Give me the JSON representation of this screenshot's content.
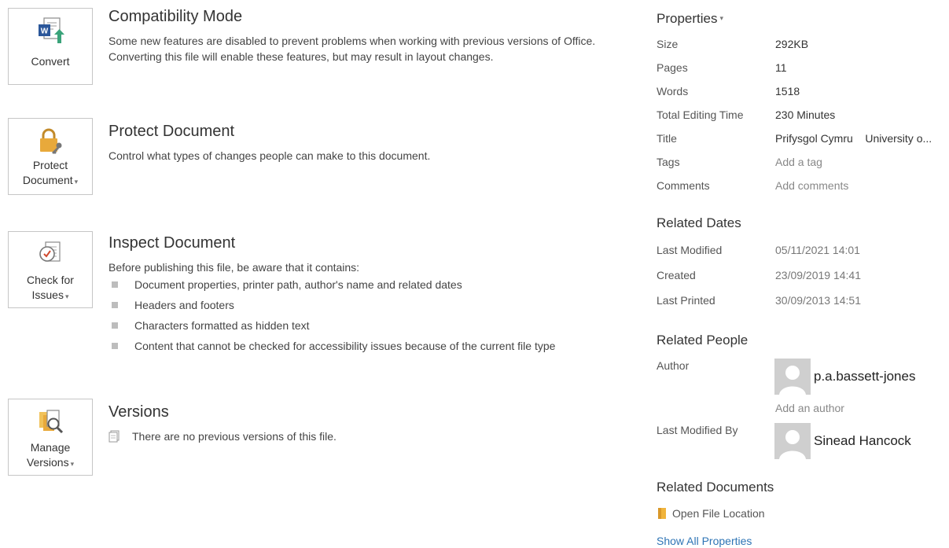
{
  "sections": {
    "compat": {
      "button_label": "Convert",
      "title": "Compatibility Mode",
      "description": "Some new features are disabled to prevent problems when working with previous versions of Office. Converting this file will enable these features, but may result in layout changes.",
      "icon": "word-convert-icon"
    },
    "protect": {
      "button_label_line1": "Protect",
      "button_label_line2": "Document",
      "title": "Protect Document",
      "description": "Control what types of changes people can make to this document.",
      "icon": "lock-key-icon"
    },
    "inspect": {
      "button_label_line1": "Check for",
      "button_label_line2": "Issues",
      "title": "Inspect Document",
      "intro": "Before publishing this file, be aware that it contains:",
      "items": [
        "Document properties, printer path, author's name and related dates",
        "Headers and footers",
        "Characters formatted as hidden text",
        "Content that cannot be checked for accessibility issues because of the current file type"
      ],
      "icon": "inspect-document-icon"
    },
    "versions": {
      "button_label_line1": "Manage",
      "button_label_line2": "Versions",
      "title": "Versions",
      "message": "There are no previous versions of this file.",
      "icon": "manage-versions-icon"
    }
  },
  "properties": {
    "header": "Properties",
    "rows": [
      {
        "key": "Size",
        "value": "292KB"
      },
      {
        "key": "Pages",
        "value": "11"
      },
      {
        "key": "Words",
        "value": "1518"
      },
      {
        "key": "Total Editing Time",
        "value": "230 Minutes"
      },
      {
        "key": "Title",
        "value": "Prifysgol Cymru    University o..."
      },
      {
        "key": "Tags",
        "value": "Add a tag"
      },
      {
        "key": "Comments",
        "value": "Add comments"
      }
    ]
  },
  "related_dates": {
    "header": "Related Dates",
    "rows": [
      {
        "key": "Last Modified",
        "value": "05/11/2021 14:01"
      },
      {
        "key": "Created",
        "value": "23/09/2019 14:41"
      },
      {
        "key": "Last Printed",
        "value": "30/09/2013 14:51"
      }
    ]
  },
  "related_people": {
    "header": "Related People",
    "author_label": "Author",
    "author_name": "p.a.bassett-jones",
    "add_author": "Add an author",
    "modified_by_label": "Last Modified By",
    "modified_by_name": "Sinead Hancock"
  },
  "related_documents": {
    "header": "Related Documents",
    "open_location": "Open File Location",
    "show_all": "Show All Properties"
  },
  "colors": {
    "link_blue": "#2e74b5",
    "word_blue": "#2b579a",
    "lock_gold": "#e8a93b"
  }
}
